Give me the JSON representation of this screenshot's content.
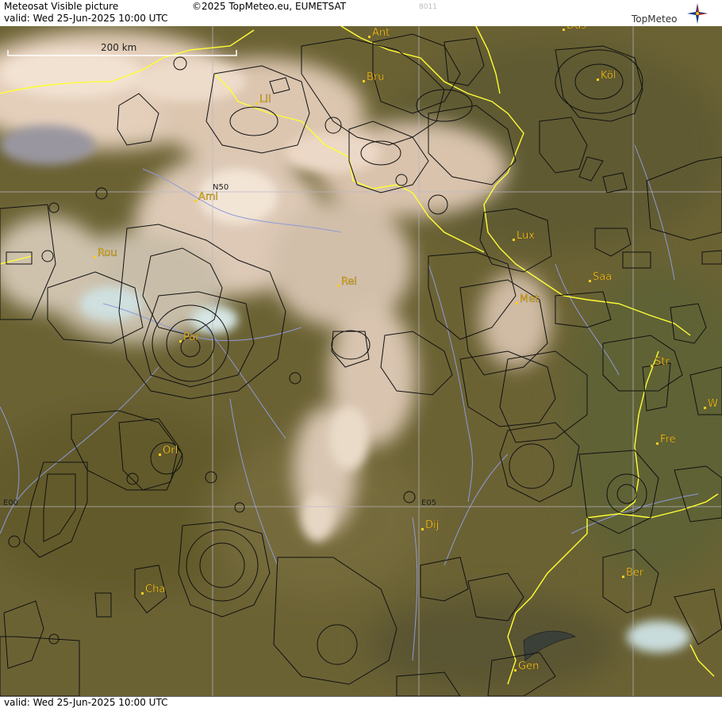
{
  "header": {
    "title": "Meteosat Visible picture",
    "valid": "valid:  Wed  25-Jun-2025  10:00 UTC",
    "copyright": "©2025 TopMeteo.eu, EUMETSAT",
    "code": "8011",
    "logo_text": "TopMeteo",
    "logo_icon": "compass-star-icon"
  },
  "scale_bar": {
    "label": "200 km"
  },
  "grid_labels": {
    "lat": "N50",
    "lon0": "E00",
    "lon5": "E05"
  },
  "cities": [
    {
      "key": "ant",
      "label": "Ant"
    },
    {
      "key": "dus",
      "label": "Düs"
    },
    {
      "key": "bru",
      "label": "Bru"
    },
    {
      "key": "kol",
      "label": "Köl"
    },
    {
      "key": "lil",
      "label": "Lil"
    },
    {
      "key": "ami",
      "label": "Ami"
    },
    {
      "key": "lux",
      "label": "Lux"
    },
    {
      "key": "rou",
      "label": "Rou"
    },
    {
      "key": "rei",
      "label": "Rei"
    },
    {
      "key": "saa",
      "label": "Saa"
    },
    {
      "key": "met",
      "label": "Met"
    },
    {
      "key": "par",
      "label": "Par"
    },
    {
      "key": "str",
      "label": "Str"
    },
    {
      "key": "w",
      "label": "W"
    },
    {
      "key": "fre",
      "label": "Fre"
    },
    {
      "key": "orl",
      "label": "Orl"
    },
    {
      "key": "dij",
      "label": "Dij"
    },
    {
      "key": "ber",
      "label": "Ber"
    },
    {
      "key": "cha",
      "label": "Cha"
    },
    {
      "key": "gen",
      "label": "Gen"
    }
  ],
  "colors": {
    "land": "#6f6536",
    "cloud": "#e8d6c2",
    "border": "#ffff33",
    "label": "#ffcc22",
    "river": "#8e9ad8"
  },
  "footer": {
    "valid": "valid:  Wed  25-Jun-2025  10:00 UTC"
  }
}
